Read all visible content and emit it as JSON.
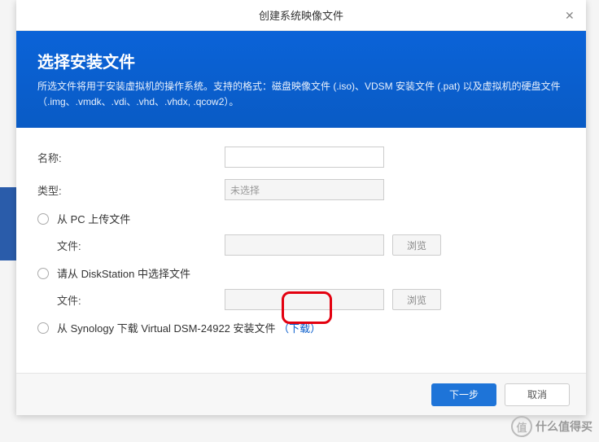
{
  "dialog": {
    "title": "创建系统映像文件"
  },
  "header": {
    "title": "选择安装文件",
    "description": "所选文件将用于安装虚拟机的操作系统。支持的格式：磁盘映像文件 (.iso)、VDSM 安装文件 (.pat) 以及虚拟机的硬盘文件（.img、.vmdk、.vdi、.vhd、.vhdx, .qcow2）。"
  },
  "form": {
    "name_label": "名称:",
    "name_value": "",
    "type_label": "类型:",
    "type_value": "未选择",
    "option_pc": "从 PC 上传文件",
    "option_ds": "请从 DiskStation 中选择文件",
    "option_synology_prefix": "从 Synology 下载 Virtual DSM-24922 安装文件",
    "download_text": "（下载）",
    "file_label": "文件:",
    "file_value_1": "",
    "file_value_2": "",
    "browse": "浏览"
  },
  "footer": {
    "next": "下一步",
    "cancel": "取消"
  },
  "watermark": {
    "symbol": "值",
    "text": "什么值得买"
  }
}
